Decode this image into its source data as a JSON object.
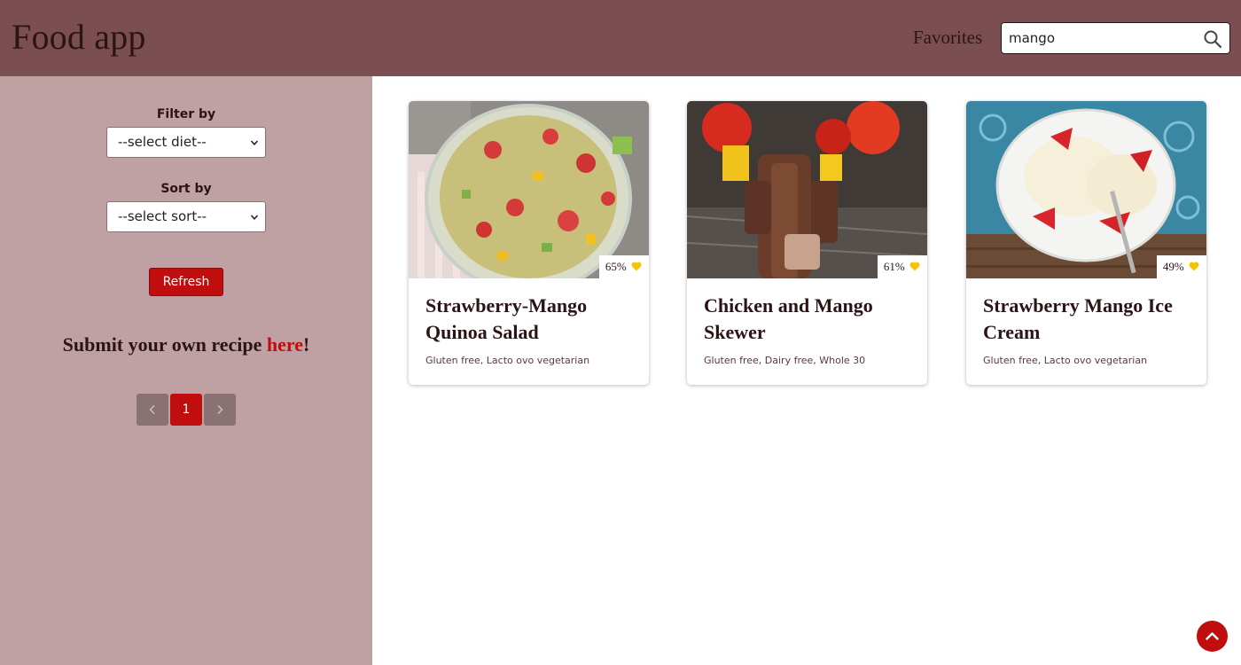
{
  "header": {
    "logo": "Food app",
    "favorites": "Favorites",
    "search_value": "mango"
  },
  "sidebar": {
    "filter_label": "Filter by",
    "filter_select": "--select diet--",
    "sort_label": "Sort by",
    "sort_select": "--select sort--",
    "refresh": "Refresh",
    "submit_text": "Submit your own recipe ",
    "submit_link": "here",
    "submit_end": "!",
    "pagination": {
      "current": "1"
    }
  },
  "recipes": [
    {
      "title": "Strawberry-Mango Quinoa Salad",
      "diets": "Gluten free, Lacto ovo vegetarian",
      "rating": "65%"
    },
    {
      "title": "Chicken and Mango Skewer",
      "diets": "Gluten free, Dairy free, Whole 30",
      "rating": "61%"
    },
    {
      "title": "Strawberry Mango Ice Cream",
      "diets": "Gluten free, Lacto ovo vegetarian",
      "rating": "49%"
    }
  ],
  "colors": {
    "header_bg": "#7b4f52",
    "sidebar_bg": "#bfa1a3",
    "accent_red": "#c00d0d",
    "heart_yellow": "#f5c400"
  }
}
